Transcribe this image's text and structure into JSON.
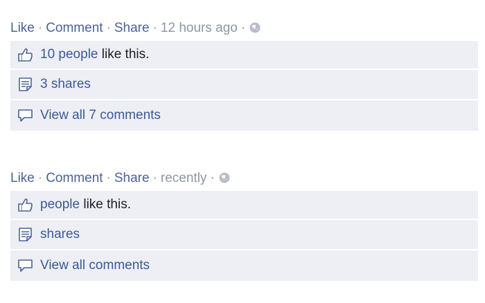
{
  "posts": [
    {
      "actions": {
        "like": "Like",
        "comment": "Comment",
        "share": "Share",
        "time": "12 hours ago",
        "sep": "·"
      },
      "likes": {
        "count": "10",
        "people": "people",
        "suffix": "like this."
      },
      "shares": {
        "count": "3",
        "label": "shares"
      },
      "comments": {
        "prefix": "View all",
        "count": "7",
        "label": "comments"
      }
    },
    {
      "actions": {
        "like": "Like",
        "comment": "Comment",
        "share": "Share",
        "time": "recently",
        "sep": "·"
      },
      "likes": {
        "people": "people",
        "suffix": "like this."
      },
      "shares": {
        "label": "shares"
      },
      "comments": {
        "prefix": "View all",
        "label": "comments"
      }
    }
  ],
  "icons": {
    "like": "thumbs-up-icon",
    "share": "share-doc-icon",
    "comment": "comment-bubble-icon",
    "globe": "globe-icon"
  },
  "colors": {
    "link": "#3b5998",
    "muted": "#8f95a0",
    "row_bg": "#edeff4"
  }
}
